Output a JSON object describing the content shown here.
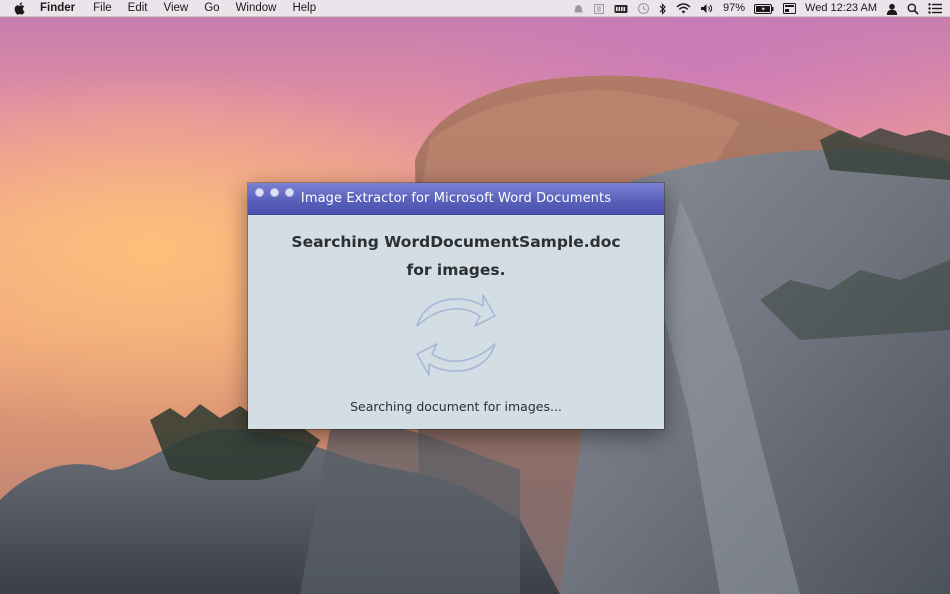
{
  "menubar": {
    "app_name": "Finder",
    "menus": [
      "File",
      "Edit",
      "View",
      "Go",
      "Window",
      "Help"
    ],
    "battery_percent": "97%",
    "clock": "Wed 12:23 AM",
    "status_icons": [
      "app-status-icon",
      "app-status-icon-2",
      "memory-icon",
      "time-machine-icon",
      "bluetooth-icon",
      "wifi-icon",
      "volume-icon",
      "battery-icon",
      "screen-icon",
      "user-icon",
      "spotlight-icon",
      "notification-center-icon"
    ]
  },
  "window": {
    "title": "Image Extractor for Microsoft Word Documents",
    "heading_line1": "Searching WordDocumentSample.doc",
    "heading_line2": "for images.",
    "status": "Searching document for images..."
  },
  "colors": {
    "titlebar": "#5a61bb",
    "window_bg": "#d3dde4",
    "spinner": "#a9b7d6"
  }
}
